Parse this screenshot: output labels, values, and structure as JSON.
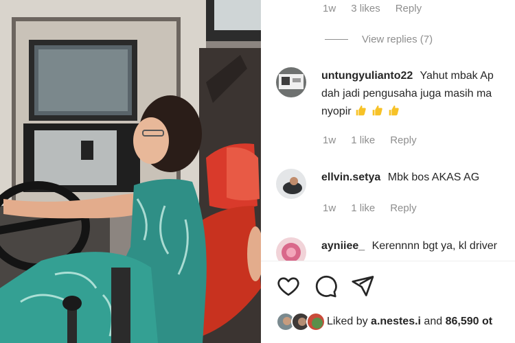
{
  "top_reply_meta": {
    "time": "1w",
    "likes": "3 likes",
    "reply": "Reply"
  },
  "view_replies": "View replies (7)",
  "comments": [
    {
      "username": "untungyulianto22",
      "lines": [
        "Yahut mbak Ap",
        "dah jadi pengusaha juga masih ma",
        "nyopir"
      ],
      "emoji": "thumbs-up-emoji ×3",
      "time": "1w",
      "likes": "1 like",
      "reply": "Reply"
    },
    {
      "username": "ellvin.setya",
      "lines": [
        "Mbk bos AKAS AG"
      ],
      "time": "1w",
      "likes": "1 like",
      "reply": "Reply"
    },
    {
      "username": "ayniiee_",
      "lines": [
        "Kerennnn bgt ya, kl driver"
      ]
    }
  ],
  "actions": {
    "like_icon": "heart-icon",
    "comment_icon": "comment-icon",
    "share_icon": "send-icon"
  },
  "liked_by": {
    "prefix": "Liked by ",
    "user": "a.nestes.i",
    "middle": " and ",
    "count": "86,590 ot"
  },
  "colors": {
    "meta_gray": "#8e8e8e",
    "text": "#262626",
    "seat_red": "#d93a2b",
    "dress_teal": "#2f8f86"
  }
}
